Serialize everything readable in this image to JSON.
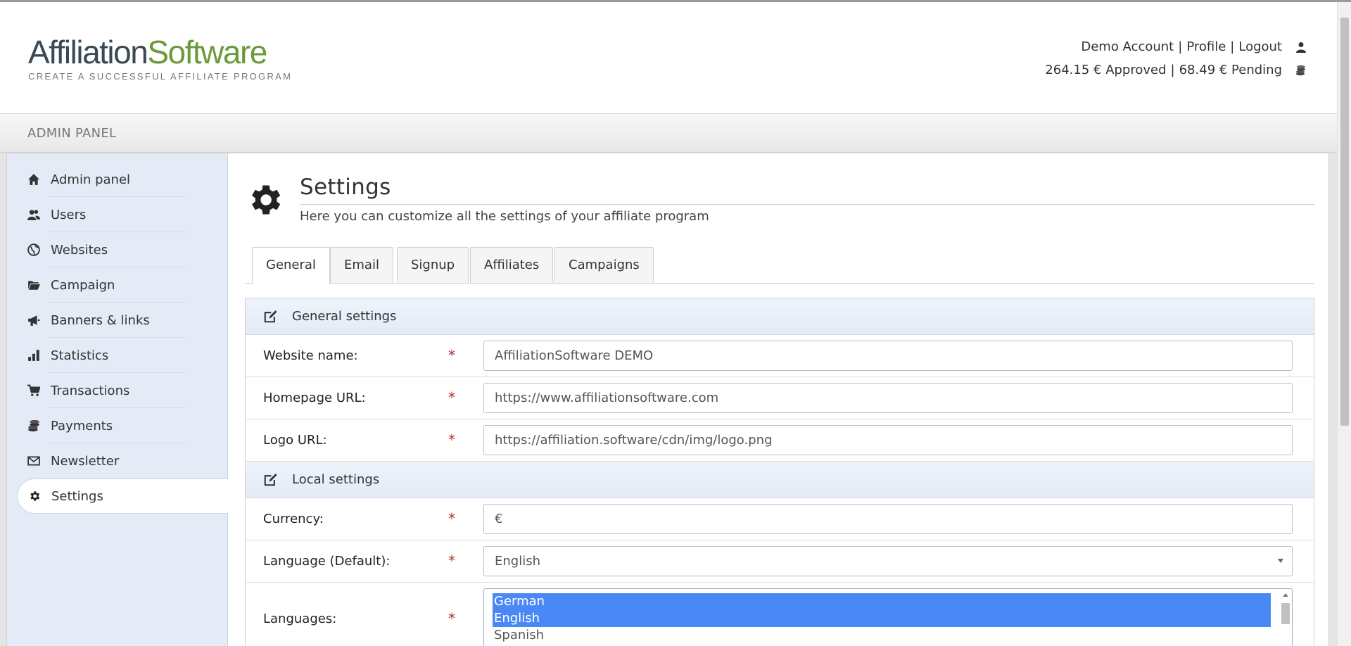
{
  "brand": {
    "logo_part1": "Affiliation",
    "logo_part2": "Software",
    "tagline": "CREATE A SUCCESSFUL AFFILIATE PROGRAM",
    "color_dark": "#3a4a55",
    "color_green": "#6b9a3a"
  },
  "account": {
    "name": "Demo Account",
    "profile": "Profile",
    "logout": "Logout",
    "separator": "|",
    "approved": "264.15 € Approved",
    "pending": "68.49 € Pending",
    "user_icon": "user-icon",
    "coins_icon": "coins-icon"
  },
  "panel": {
    "title": "ADMIN PANEL"
  },
  "sidebar": {
    "items": [
      {
        "label": "Admin panel",
        "icon": "home-icon"
      },
      {
        "label": "Users",
        "icon": "users-icon"
      },
      {
        "label": "Websites",
        "icon": "globe-icon"
      },
      {
        "label": "Campaign",
        "icon": "folder-icon"
      },
      {
        "label": "Banners & links",
        "icon": "megaphone-icon"
      },
      {
        "label": "Statistics",
        "icon": "bar-chart-icon"
      },
      {
        "label": "Transactions",
        "icon": "cart-icon"
      },
      {
        "label": "Payments",
        "icon": "coins-icon"
      },
      {
        "label": "Newsletter",
        "icon": "envelope-icon"
      },
      {
        "label": "Settings",
        "icon": "gear-icon",
        "active": true
      }
    ]
  },
  "page": {
    "title": "Settings",
    "subtitle": "Here you can customize all the settings of your affiliate program"
  },
  "tabs": [
    {
      "label": "General",
      "active": true
    },
    {
      "label": "Email"
    },
    {
      "label": "Signup"
    },
    {
      "label": "Affiliates"
    },
    {
      "label": "Campaigns"
    }
  ],
  "sections": {
    "general": {
      "title": "General settings"
    },
    "local": {
      "title": "Local settings"
    }
  },
  "fields": {
    "website_name": {
      "label": "Website name:",
      "value": "AffiliationSoftware DEMO"
    },
    "homepage_url": {
      "label": "Homepage URL:",
      "value": "https://www.affiliationsoftware.com"
    },
    "logo_url": {
      "label": "Logo URL:",
      "value": "https://affiliation.software/cdn/img/logo.png"
    },
    "currency": {
      "label": "Currency:",
      "value": "€"
    },
    "language_default": {
      "label": "Language (Default):",
      "value": "English"
    },
    "languages": {
      "label": "Languages:",
      "options": [
        {
          "label": "German",
          "selected": true
        },
        {
          "label": "English",
          "selected": true
        },
        {
          "label": "Spanish",
          "selected": false
        }
      ]
    },
    "required_mark": "*"
  },
  "colors": {
    "sidebar_bg": "#e4ebf7",
    "selected_option": "#4a89f5",
    "required": "#b03030"
  }
}
